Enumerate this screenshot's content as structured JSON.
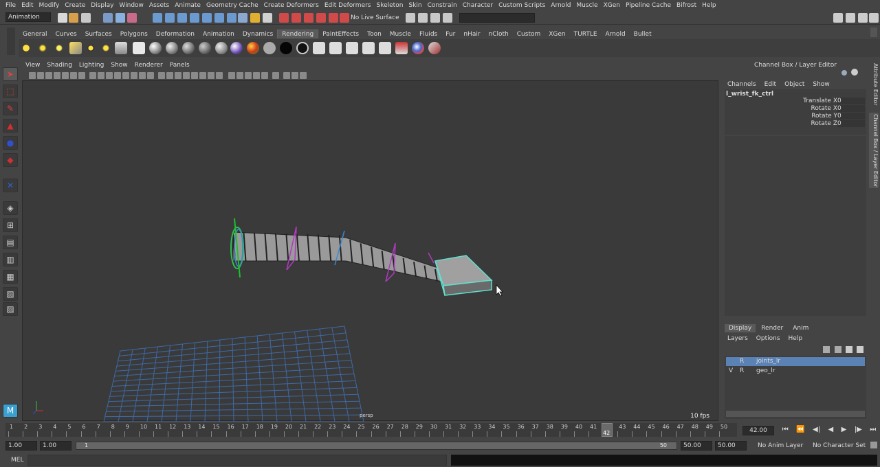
{
  "menubar": [
    "File",
    "Edit",
    "Modify",
    "Create",
    "Display",
    "Window",
    "Assets",
    "Animate",
    "Geometry Cache",
    "Create Deformers",
    "Edit Deformers",
    "Skeleton",
    "Skin",
    "Constrain",
    "Character",
    "Custom Scripts",
    "Arnold",
    "Muscle",
    "XGen",
    "Pipeline Cache",
    "Bifrost",
    "Help"
  ],
  "status": {
    "menuset": "Animation",
    "live_surface": "No Live Surface"
  },
  "shelf_tabs": [
    "General",
    "Curves",
    "Surfaces",
    "Polygons",
    "Deformation",
    "Animation",
    "Dynamics",
    "Rendering",
    "PaintEffects",
    "Toon",
    "Muscle",
    "Fluids",
    "Fur",
    "nHair",
    "nCloth",
    "Custom",
    "XGen",
    "TURTLE",
    "Arnold",
    "Bullet"
  ],
  "active_shelf_tab": "Rendering",
  "viewport": {
    "menus": [
      "View",
      "Shading",
      "Lighting",
      "Show",
      "Renderer",
      "Panels"
    ],
    "camera_label": "persp",
    "fps": "10 fps"
  },
  "channel_box": {
    "title": "Channel Box / Layer Editor",
    "menus": [
      "Channels",
      "Edit",
      "Object",
      "Show"
    ],
    "object": "l_wrist_fk_ctrl",
    "channels": [
      {
        "name": "Translate X",
        "value": "0"
      },
      {
        "name": "Rotate X",
        "value": "0"
      },
      {
        "name": "Rotate Y",
        "value": "0"
      },
      {
        "name": "Rotate Z",
        "value": "0"
      }
    ],
    "side_tabs": [
      "Attribute Editor",
      "Channel Box / Layer Editor"
    ]
  },
  "layer_editor": {
    "tabs": [
      "Display",
      "Render",
      "Anim"
    ],
    "menus": [
      "Layers",
      "Options",
      "Help"
    ],
    "layers": [
      {
        "v": "",
        "r": "R",
        "name": "joints_lr",
        "selected": true
      },
      {
        "v": "V",
        "r": "R",
        "name": "geo_lr",
        "selected": false
      }
    ]
  },
  "timeline": {
    "ticks": [
      "1",
      "2",
      "3",
      "4",
      "5",
      "6",
      "7",
      "8",
      "9",
      "10",
      "11",
      "12",
      "13",
      "14",
      "15",
      "16",
      "17",
      "18",
      "19",
      "20",
      "21",
      "22",
      "23",
      "24",
      "25",
      "26",
      "27",
      "28",
      "29",
      "30",
      "31",
      "32",
      "33",
      "34",
      "35",
      "36",
      "37",
      "38",
      "39",
      "40",
      "41",
      "42",
      "43",
      "44",
      "45",
      "46",
      "47",
      "48",
      "49",
      "50"
    ],
    "current_frame": "42",
    "current_field": "42.00"
  },
  "range": {
    "start": "1.00",
    "start2": "1.00",
    "slider_start": "1",
    "slider_end": "50",
    "end": "50.00",
    "end2": "50.00",
    "anim_layer": "No Anim Layer",
    "char_set": "No Character Set"
  },
  "command_line": {
    "label": "MEL"
  }
}
